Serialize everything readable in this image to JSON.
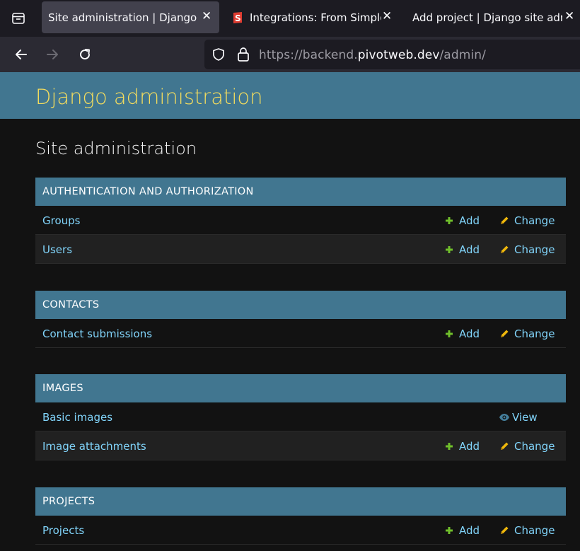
{
  "browser": {
    "tabs": [
      {
        "label": "Site administration | Django site admin",
        "active": true
      },
      {
        "label": "Integrations: From Simple Django to Wagtail",
        "active": false
      },
      {
        "label": "Add project | Django site admin",
        "active": false
      }
    ],
    "url": {
      "prefix": "https://backend.",
      "domain": "pivotweb.dev",
      "path": "/admin/"
    }
  },
  "site": {
    "branding": "Django administration",
    "page_title": "Site administration"
  },
  "actions": {
    "add": "Add",
    "change": "Change",
    "view": "View"
  },
  "modules": [
    {
      "caption": "AUTHENTICATION AND AUTHORIZATION",
      "models": [
        {
          "name": "Groups"
        },
        {
          "name": "Users"
        }
      ]
    },
    {
      "caption": "CONTACTS",
      "models": [
        {
          "name": "Contact submissions"
        }
      ]
    },
    {
      "caption": "IMAGES",
      "models": [
        {
          "name": "Basic images"
        },
        {
          "name": "Image attachments"
        }
      ]
    },
    {
      "caption": "PROJECTS",
      "models": [
        {
          "name": "Projects"
        }
      ]
    }
  ],
  "colors": {
    "header": "#417690",
    "branding": "#f5dd5d",
    "link": "#81d4fa",
    "add_icon": "#70bf2b",
    "change_icon": "#efb80b",
    "view_icon": "#447e9b"
  }
}
